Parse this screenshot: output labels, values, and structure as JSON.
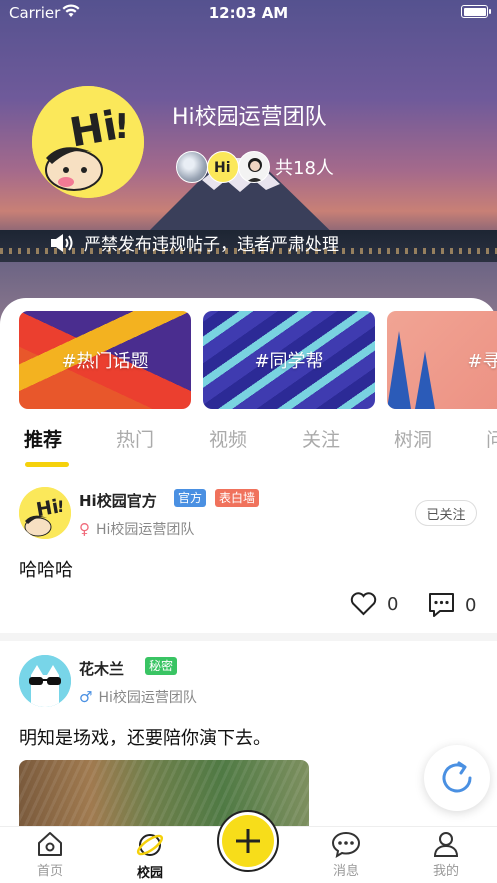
{
  "status_bar": {
    "carrier": "Carrier",
    "time": "12:03 AM"
  },
  "group": {
    "title": "Hi校园运营团队",
    "member_count": "共18人",
    "notice": "严禁发布违规帖子，违者严肃处理"
  },
  "topics": [
    {
      "label": "#热门话题"
    },
    {
      "label": "#同学帮"
    },
    {
      "label": "#寻物"
    }
  ],
  "tabs": [
    {
      "label": "推荐",
      "active": true
    },
    {
      "label": "热门"
    },
    {
      "label": "视频"
    },
    {
      "label": "关注"
    },
    {
      "label": "树洞"
    },
    {
      "label": "问"
    }
  ],
  "posts": [
    {
      "author": "Hi校园官方",
      "badges": [
        "官方",
        "表白墙"
      ],
      "gender": "female",
      "group": "Hi校园运营团队",
      "follow_label": "已关注",
      "text": "哈哈哈",
      "likes": "0",
      "comments": "0"
    },
    {
      "author": "花木兰",
      "badges": [
        "秘密"
      ],
      "gender": "male",
      "group": "Hi校园运营团队",
      "text": "明知是场戏，还要陪你演下去。"
    }
  ],
  "tabbar": [
    {
      "label": "首页",
      "icon": "home-icon"
    },
    {
      "label": "校园",
      "icon": "planet-icon",
      "active": true
    },
    {
      "label": "",
      "icon": "plus-icon"
    },
    {
      "label": "消息",
      "icon": "message-icon"
    },
    {
      "label": "我的",
      "icon": "user-icon"
    }
  ],
  "colors": {
    "accent": "#f5d10b",
    "official_badge": "#4a90e2",
    "confession_badge": "#f0725c",
    "secret_badge": "#39c463",
    "refresh_icon": "#4a90e2"
  }
}
